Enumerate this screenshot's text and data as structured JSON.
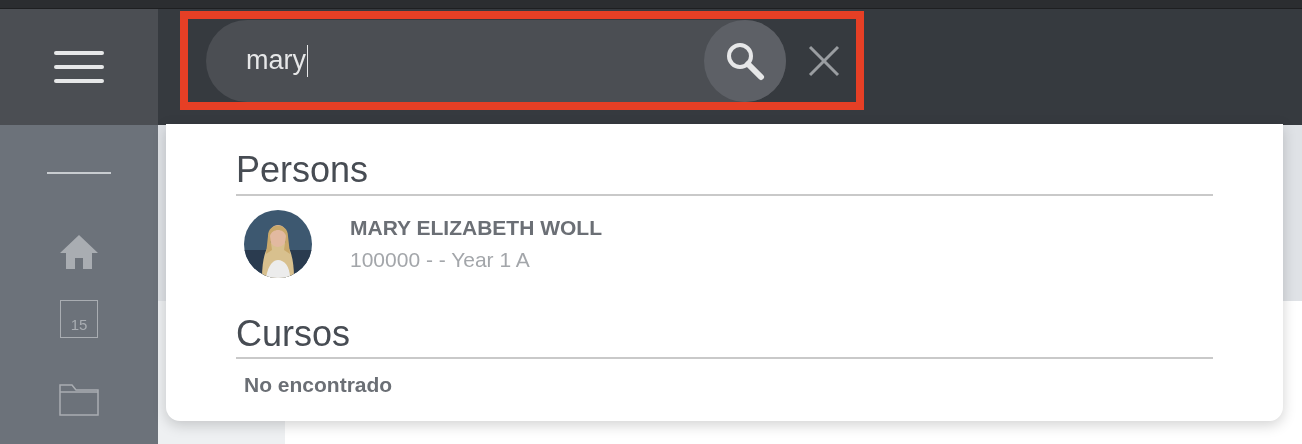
{
  "search": {
    "value": "mary"
  },
  "sidebar": {
    "calendar_day": "15"
  },
  "results": {
    "sections": [
      {
        "title": "Persons",
        "kind": "persons",
        "items": [
          {
            "name": "MARY ELIZABETH WOLL",
            "detail": "100000 - - Year 1 A"
          }
        ]
      },
      {
        "title": "Cursos",
        "kind": "empty",
        "message": "No encontrado"
      }
    ]
  }
}
